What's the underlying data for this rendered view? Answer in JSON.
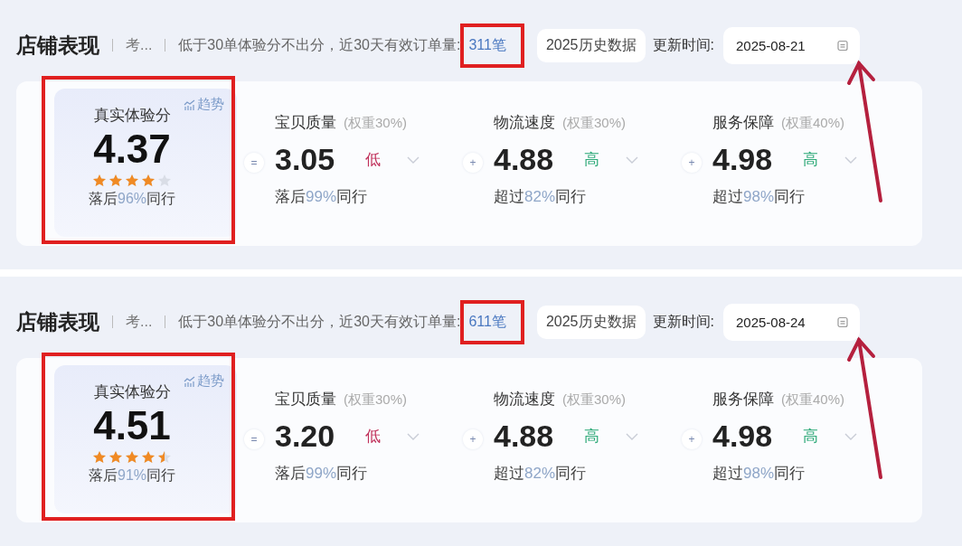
{
  "panels": [
    {
      "title": "店铺表现",
      "tab": "考...",
      "notice": "低于30单体验分不出分，近30天有效订单量:",
      "order_count": "311笔",
      "count_highlighted": true,
      "history_button": "2025历史数据",
      "update_label": "更新时间:",
      "update_date": "2025-08-21",
      "date_highlighted": true,
      "score": {
        "title": "真实体验分",
        "trend": "趋势",
        "value": "4.37",
        "stars": 4,
        "compare": "落后",
        "percent": "96%",
        "peers": "同行",
        "highlighted": true
      },
      "metrics": [
        {
          "operator": "=",
          "name": "宝贝质量",
          "weight": "(权重30%)",
          "value": "3.05",
          "is_high": false,
          "rating_text": "低",
          "compare": "落后",
          "percent": "99%",
          "peers": "同行"
        },
        {
          "operator": "+",
          "name": "物流速度",
          "weight": "(权重30%)",
          "value": "4.88",
          "is_high": true,
          "rating_text": "高",
          "compare": "超过",
          "percent": "82%",
          "peers": "同行"
        },
        {
          "operator": "+",
          "name": "服务保障",
          "weight": "(权重40%)",
          "value": "4.98",
          "is_high": true,
          "rating_text": "高",
          "compare": "超过",
          "percent": "98%",
          "peers": "同行"
        }
      ]
    },
    {
      "title": "店铺表现",
      "tab": "考...",
      "notice": "低于30单体验分不出分，近30天有效订单量:",
      "order_count": "611笔",
      "count_highlighted": true,
      "history_button": "2025历史数据",
      "update_label": "更新时间:",
      "update_date": "2025-08-24",
      "date_highlighted": true,
      "score": {
        "title": "真实体验分",
        "trend": "趋势",
        "value": "4.51",
        "stars": 4.5,
        "compare": "落后",
        "percent": "91%",
        "peers": "同行",
        "highlighted": true
      },
      "metrics": [
        {
          "operator": "=",
          "name": "宝贝质量",
          "weight": "(权重30%)",
          "value": "3.20",
          "is_high": false,
          "rating_text": "低",
          "compare": "落后",
          "percent": "99%",
          "peers": "同行"
        },
        {
          "operator": "+",
          "name": "物流速度",
          "weight": "(权重30%)",
          "value": "4.88",
          "is_high": true,
          "rating_text": "高",
          "compare": "超过",
          "percent": "82%",
          "peers": "同行"
        },
        {
          "operator": "+",
          "name": "服务保障",
          "weight": "(权重40%)",
          "value": "4.98",
          "is_high": true,
          "rating_text": "高",
          "compare": "超过",
          "percent": "98%",
          "peers": "同行"
        }
      ]
    }
  ]
}
